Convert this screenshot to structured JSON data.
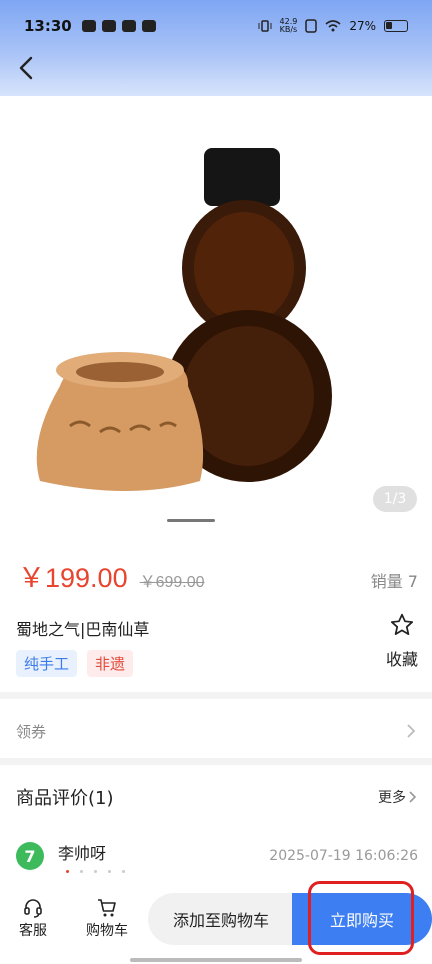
{
  "status_bar": {
    "time": "13:30",
    "net_speed_value": "42.9",
    "net_speed_unit": "KB/s",
    "battery": "27%"
  },
  "nav": {
    "back_icon": "chevron-left-icon"
  },
  "gallery": {
    "counter": "1/3"
  },
  "product": {
    "price": "￥199.00",
    "original_price": "￥699.00",
    "sales": "销量 7",
    "title": "蜀地之气|巴南仙草",
    "tags": [
      "纯手工",
      "非遗"
    ],
    "favorite_label": "收藏"
  },
  "coupon": {
    "label": "领券"
  },
  "reviews": {
    "title": "商品评价(1)",
    "more_label": "更多",
    "items": [
      {
        "name": "李帅呀",
        "date": "2025-07-19 16:06:26",
        "avatar_letter": "7",
        "rating": 1
      }
    ]
  },
  "bottom_bar": {
    "service_label": "客服",
    "cart_label": "购物车",
    "add_cart_label": "添加至购物车",
    "buy_now_label": "立即购买"
  },
  "colors": {
    "accent": "#3d7ef2",
    "price": "#e8442e",
    "highlight": "#e02020"
  }
}
